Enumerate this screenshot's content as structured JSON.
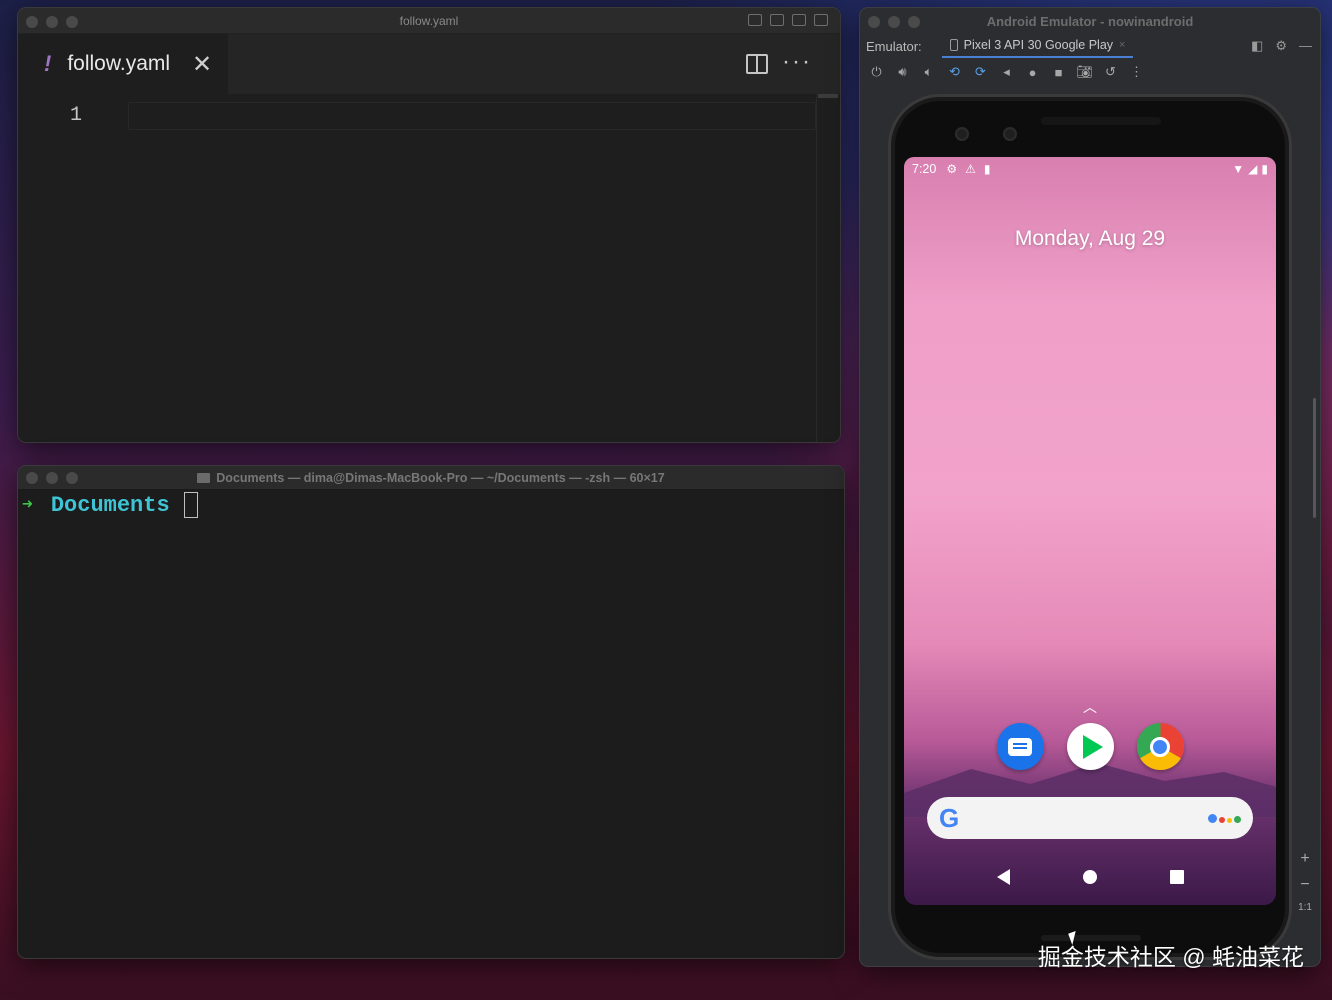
{
  "vscode": {
    "window_title": "follow.yaml",
    "tab": {
      "icon_glyph": "!",
      "label": "follow.yaml",
      "close_glyph": "✕"
    },
    "more_glyph": "···",
    "line_number": "1"
  },
  "terminal": {
    "window_title": "Documents — dima@Dimas-MacBook-Pro — ~/Documents — -zsh — 60×17",
    "prompt_arrow": "➜",
    "prompt_dir": "Documents"
  },
  "emulator": {
    "window_title": "Android Emulator - nowinandroid",
    "label": "Emulator:",
    "device_tab": "Pixel 3 API 30 Google Play",
    "device_tab_close": "×",
    "zoom_plus": "+",
    "zoom_minus": "−",
    "zoom_ratio": "1:1"
  },
  "phone": {
    "time": "7:20",
    "date": "Monday, Aug 29",
    "swipe_glyph": "︿",
    "search_logo": "G",
    "dock_apps": [
      "Messages",
      "Play Store",
      "Chrome"
    ]
  },
  "watermark": "掘金技术社区 @ 蚝油菜花",
  "colors": {
    "accent_blue": "#4a7fd1",
    "terminal_green": "#3fc24a",
    "terminal_cyan": "#3ec4d4",
    "yaml_purple": "#a074c4"
  }
}
